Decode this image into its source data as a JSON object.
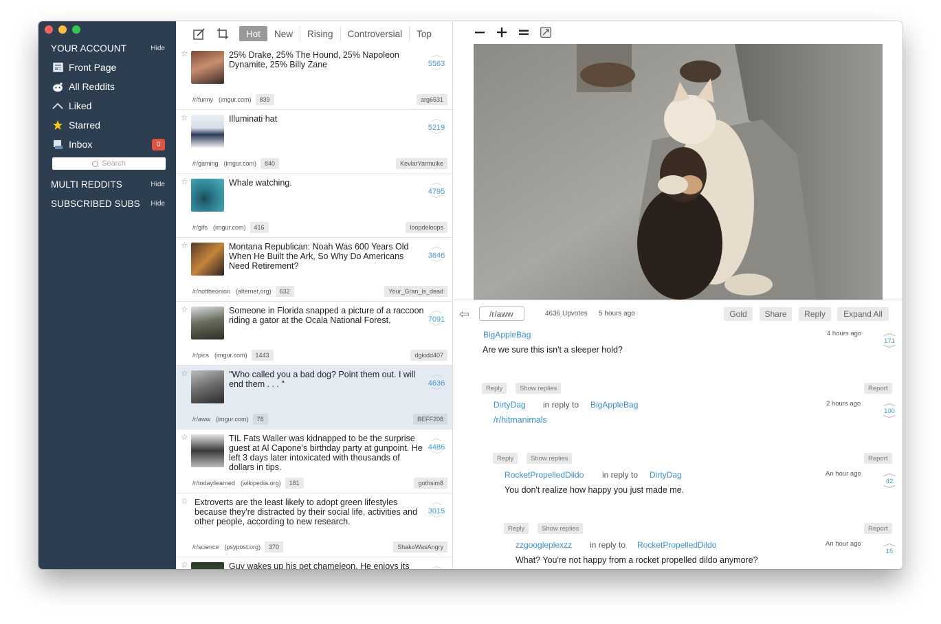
{
  "sidebar": {
    "account_title": "YOUR ACCOUNT",
    "hide_label": "Hide",
    "items": [
      {
        "label": "Front Page",
        "icon": "newspaper-icon"
      },
      {
        "label": "All Reddits",
        "icon": "reddit-alien-icon"
      },
      {
        "label": "Liked",
        "icon": "chevron-up-icon"
      },
      {
        "label": "Starred",
        "icon": "star-icon"
      },
      {
        "label": "Inbox",
        "icon": "inbox-icon",
        "badge": "0"
      }
    ],
    "search_placeholder": "Search",
    "multi_title": "MULTI REDDITS",
    "subscribed_title": "SUBSCRIBED SUBS"
  },
  "toolbar": {
    "tabs": [
      "Hot",
      "New",
      "Rising",
      "Controversial",
      "Top"
    ],
    "active_tab": "Hot"
  },
  "posts": [
    {
      "title": "25% Drake, 25% The Hound, 25% Napoleon Dynamite, 25% Billy Zane",
      "votes": "5563",
      "sub": "/r/funny",
      "domain": "(imgur.com)",
      "comments": "839",
      "author": "arg6531"
    },
    {
      "title": "Illuminati hat",
      "votes": "5219",
      "sub": "/r/gaming",
      "domain": "(imgur.com)",
      "comments": "840",
      "author": "KevlarYarmulke"
    },
    {
      "title": "Whale watching.",
      "votes": "4795",
      "sub": "/r/gifs",
      "domain": "(imgur.com)",
      "comments": "416",
      "author": "loopdeloops"
    },
    {
      "title": "Montana Republican: Noah Was 600 Years Old When He Built the Ark, So Why Do Americans Need Retirement?",
      "votes": "3646",
      "sub": "/r/nottheonion",
      "domain": "(alternet.org)",
      "comments": "632",
      "author": "Your_Gran_is_dead"
    },
    {
      "title": "Someone in Florida snapped a picture of a raccoon riding a gator at the Ocala National Forest.",
      "votes": "7091",
      "sub": "/r/pics",
      "domain": "(imgur.com)",
      "comments": "1443",
      "author": "dgkidd407"
    },
    {
      "title": "\"Who called you a bad dog? Point them out. I will end them . . . \"",
      "votes": "4636",
      "sub": "/r/aww",
      "domain": "(imgur.com)",
      "comments": "78",
      "author": "BEFF208"
    },
    {
      "title": "TIL Fats Waller was kidnapped to be the surprise guest at Al Capone's birthday party at gunpoint. He left 3 days later intoxicated with thousands of dollars in tips.",
      "votes": "4486",
      "sub": "/r/todayilearned",
      "domain": "(wikipedia.org)",
      "comments": "181",
      "author": "gothsim8"
    },
    {
      "title": "Extroverts are the least likely to adopt green lifestyles because they're distracted by their social life, activities and other people, according to new research.",
      "votes": "3015",
      "sub": "/r/science",
      "domain": "(psypost.org)",
      "comments": "370",
      "author": "ShakoWasAngry"
    },
    {
      "title": "Guy wakes up his pet chameleon. He enjoys its",
      "votes": "",
      "sub": "",
      "domain": "",
      "comments": "",
      "author": ""
    }
  ],
  "detail": {
    "subreddit": "/r/aww",
    "upvotes": "4636 Upvotes",
    "time": "5 hours ago",
    "actions": [
      "Gold",
      "Share",
      "Reply",
      "Expand All"
    ],
    "reply_label": "Reply",
    "show_replies_label": "Show replies",
    "report_label": "Report",
    "in_reply_to": "in reply to",
    "comments": [
      {
        "author": "BigAppleBag",
        "time": "4 hours ago",
        "body": "Are we sure this isn't a sleeper hold?",
        "votes": "171"
      },
      {
        "author": "DirtyDag",
        "reply_to": "BigAppleBag",
        "time": "2 hours ago",
        "body": "/r/hitmanimals",
        "votes": "100"
      },
      {
        "author": "RocketPropelledDildo",
        "reply_to": "DirtyDag",
        "time": "An hour ago",
        "body": "You don't realize how happy you just made me.",
        "votes": "42"
      },
      {
        "author": "zzgoogleplexzz",
        "reply_to": "RocketPropelledDildo",
        "time": "An hour ago",
        "body": "What? You're not happy from a rocket propelled dildo anymore?",
        "votes": "15"
      }
    ]
  },
  "colors": {
    "sidebar": "#2c3e50",
    "accent": "#3a8fcf",
    "badge": "#e0533f",
    "selected_row": "#e3eaf2"
  }
}
